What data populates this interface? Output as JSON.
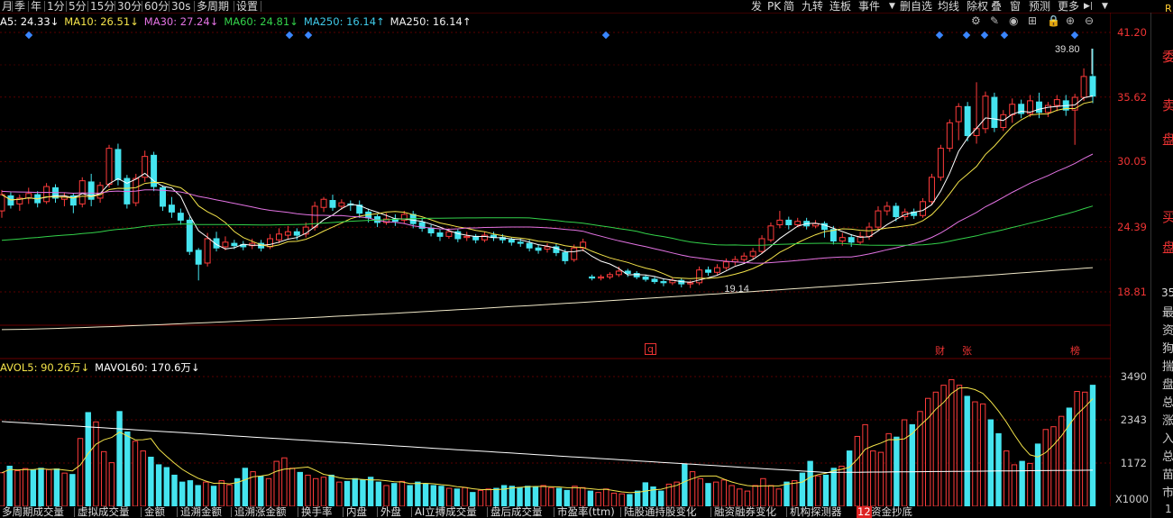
{
  "toolbar_left": [
    "月",
    "季",
    "年",
    "1分",
    "5分",
    "15分",
    "30分",
    "60分",
    "30s",
    "多周期",
    "设置"
  ],
  "toolbar_right": [
    "发",
    "PK",
    "简",
    "九转",
    "连板",
    "事件",
    "删自选",
    "均线",
    "除权",
    "叠",
    "窗",
    "预测",
    "更多"
  ],
  "ma_legend": [
    {
      "label": "A5: 24.33↓",
      "color": "#ffffff"
    },
    {
      "label": "MA10: 26.51↓",
      "color": "#f3e34a"
    },
    {
      "label": "MA30: 27.24↓",
      "color": "#e373e3"
    },
    {
      "label": "MA60: 24.81↓",
      "color": "#33d24a"
    },
    {
      "label": "MA250: 16.14↑",
      "color": "#3fc9e8"
    },
    {
      "label": "MA250: 16.14↑",
      "color": "#f0f0f0"
    }
  ],
  "vol_legend": [
    {
      "label": "AVOL5: 90.26万↓",
      "color": "#f3e34a"
    },
    {
      "label": "MAVOL60: 170.6万↓",
      "color": "#ffffff"
    }
  ],
  "price_axis": [
    "41.20",
    "35.62",
    "30.05",
    "24.39",
    "18.81"
  ],
  "price_high_label": "39.80",
  "price_low_label": "19.14",
  "vol_axis": [
    "3490",
    "2343",
    "1172"
  ],
  "vol_unit": "X1000",
  "tags": {
    "q": "q",
    "cai": "财",
    "zhang": "张",
    "bang": "榜"
  },
  "bottom_tabs": [
    "多周期成交量",
    "虚拟成交量",
    "金额",
    "追溯金额",
    "追溯涨金额",
    "换手率",
    "内盘",
    "外盘",
    "AI立搏成交量",
    "盘后成交量",
    "市盈率(ttm)",
    "陆股通持股变化",
    "融资融券变化",
    "机构探测器",
    "资金抄底"
  ],
  "bottom_badge": "12",
  "right_side": [
    "R",
    "委",
    "卖",
    "盘",
    "买",
    "盘",
    "35",
    "最",
    "资",
    "狗",
    "揣",
    "盘",
    "总",
    "涨",
    "入",
    "总",
    "苗",
    "市",
    "1"
  ],
  "colors": {
    "up": "#ff3b3b",
    "down": "#45e4ef",
    "grid": "#5a0000",
    "ma5": "#ffffff",
    "ma10": "#f3e34a",
    "ma30": "#e373e3",
    "ma60": "#33d24a",
    "ma250": "#f0e8c8",
    "icon": "#3a86ff"
  },
  "chart_data": {
    "type": "candlestick",
    "candles": [
      [
        25.8,
        27.2,
        25.2,
        27.6
      ],
      [
        27.1,
        26.3,
        26.0,
        27.4
      ],
      [
        26.4,
        26.9,
        25.8,
        27.2
      ],
      [
        26.9,
        27.3,
        26.4,
        27.8
      ],
      [
        27.2,
        26.5,
        26.1,
        27.5
      ],
      [
        26.6,
        27.9,
        26.4,
        28.2
      ],
      [
        27.8,
        26.9,
        26.5,
        28.1
      ],
      [
        26.8,
        27.0,
        26.2,
        27.4
      ],
      [
        27.1,
        26.3,
        25.6,
        27.3
      ],
      [
        26.4,
        28.4,
        26.1,
        28.7
      ],
      [
        28.3,
        26.8,
        26.2,
        29.0
      ],
      [
        26.9,
        28.0,
        26.5,
        28.3
      ],
      [
        28.1,
        31.2,
        27.8,
        31.5
      ],
      [
        31.1,
        28.5,
        28.0,
        31.6
      ],
      [
        28.6,
        26.4,
        26.0,
        28.9
      ],
      [
        26.5,
        28.6,
        26.2,
        29.0
      ],
      [
        28.7,
        30.5,
        28.3,
        31.0
      ],
      [
        30.6,
        27.9,
        27.5,
        30.9
      ],
      [
        27.8,
        26.2,
        25.8,
        28.0
      ],
      [
        26.3,
        25.7,
        25.2,
        27.0
      ],
      [
        25.6,
        25.0,
        24.6,
        26.0
      ],
      [
        25.0,
        22.3,
        22.0,
        25.3
      ],
      [
        22.4,
        21.2,
        19.8,
        22.6
      ],
      [
        21.3,
        23.4,
        21.0,
        23.9
      ],
      [
        23.4,
        22.6,
        22.3,
        24.0
      ],
      [
        22.7,
        23.1,
        22.4,
        23.6
      ],
      [
        23.0,
        22.8,
        22.5,
        23.3
      ],
      [
        22.9,
        22.7,
        22.4,
        23.2
      ],
      [
        22.8,
        23.0,
        22.5,
        23.4
      ],
      [
        23.0,
        22.6,
        22.3,
        23.3
      ],
      [
        22.7,
        23.4,
        22.5,
        23.8
      ],
      [
        23.3,
        23.8,
        23.0,
        24.3
      ],
      [
        23.7,
        24.0,
        23.4,
        24.5
      ],
      [
        24.0,
        23.7,
        23.3,
        24.3
      ],
      [
        23.8,
        24.4,
        23.5,
        24.8
      ],
      [
        24.4,
        26.2,
        24.1,
        26.6
      ],
      [
        26.1,
        26.8,
        25.7,
        27.0
      ],
      [
        26.7,
        26.1,
        25.8,
        27.2
      ],
      [
        26.2,
        26.5,
        25.9,
        26.8
      ],
      [
        26.4,
        26.3,
        25.8,
        26.7
      ],
      [
        26.3,
        25.6,
        25.2,
        26.7
      ],
      [
        25.7,
        25.2,
        24.8,
        26.0
      ],
      [
        25.3,
        24.8,
        24.4,
        25.5
      ],
      [
        24.8,
        25.1,
        24.6,
        25.6
      ],
      [
        25.1,
        24.9,
        24.5,
        25.5
      ],
      [
        25.0,
        25.5,
        24.7,
        25.8
      ],
      [
        25.5,
        24.7,
        24.3,
        25.8
      ],
      [
        24.8,
        24.3,
        24.0,
        25.2
      ],
      [
        24.3,
        23.9,
        23.6,
        24.6
      ],
      [
        23.9,
        23.6,
        23.2,
        24.2
      ],
      [
        23.6,
        24.0,
        23.4,
        24.3
      ],
      [
        24.0,
        23.4,
        23.1,
        24.2
      ],
      [
        23.5,
        23.6,
        23.2,
        24.0
      ],
      [
        23.6,
        23.3,
        23.0,
        23.8
      ],
      [
        23.3,
        23.7,
        23.1,
        24.0
      ],
      [
        23.7,
        23.5,
        23.2,
        24.0
      ],
      [
        23.5,
        23.3,
        23.0,
        23.8
      ],
      [
        23.3,
        23.1,
        22.8,
        23.5
      ],
      [
        23.1,
        23.0,
        22.7,
        23.4
      ],
      [
        23.0,
        22.6,
        22.3,
        23.3
      ],
      [
        22.6,
        22.4,
        22.1,
        22.9
      ],
      [
        22.5,
        22.7,
        22.2,
        23.0
      ],
      [
        22.7,
        22.2,
        21.9,
        23.0
      ],
      [
        22.2,
        21.5,
        21.2,
        22.5
      ],
      [
        21.6,
        22.6,
        21.4,
        22.9
      ],
      [
        22.6,
        23.1,
        22.3,
        23.4
      ],
      [
        20.1,
        20.0,
        19.8,
        20.3
      ],
      [
        20.0,
        20.1,
        19.8,
        20.3
      ],
      [
        20.1,
        20.3,
        19.9,
        20.5
      ],
      [
        20.3,
        20.6,
        20.1,
        21.0
      ],
      [
        20.6,
        20.4,
        20.1,
        20.8
      ],
      [
        20.4,
        20.1,
        19.9,
        20.6
      ],
      [
        20.1,
        19.9,
        19.7,
        20.3
      ],
      [
        19.9,
        19.7,
        19.5,
        20.1
      ],
      [
        19.7,
        19.6,
        19.3,
        19.9
      ],
      [
        19.6,
        19.8,
        19.4,
        20.0
      ],
      [
        19.8,
        19.5,
        19.2,
        20.0
      ],
      [
        19.5,
        19.6,
        19.14,
        19.8
      ],
      [
        19.6,
        20.7,
        19.4,
        21.0
      ],
      [
        20.7,
        20.5,
        20.2,
        21.0
      ],
      [
        20.5,
        20.9,
        20.3,
        21.2
      ],
      [
        20.9,
        21.4,
        20.7,
        21.7
      ],
      [
        21.4,
        21.6,
        21.1,
        21.9
      ],
      [
        21.6,
        21.9,
        21.4,
        22.2
      ],
      [
        21.9,
        22.3,
        21.6,
        22.6
      ],
      [
        22.3,
        23.4,
        22.1,
        23.7
      ],
      [
        23.3,
        24.5,
        23.1,
        24.8
      ],
      [
        24.6,
        25.0,
        24.3,
        25.8
      ],
      [
        25.0,
        24.6,
        24.2,
        25.3
      ],
      [
        24.6,
        24.9,
        24.4,
        25.2
      ],
      [
        24.9,
        24.5,
        24.2,
        25.2
      ],
      [
        24.5,
        24.7,
        24.3,
        25.0
      ],
      [
        24.7,
        24.2,
        23.5,
        24.9
      ],
      [
        24.2,
        23.2,
        22.9,
        24.5
      ],
      [
        23.2,
        23.5,
        22.8,
        23.9
      ],
      [
        23.5,
        23.1,
        22.7,
        23.8
      ],
      [
        23.1,
        23.6,
        22.9,
        24.0
      ],
      [
        23.6,
        24.4,
        23.3,
        24.8
      ],
      [
        24.4,
        25.8,
        24.2,
        26.2
      ],
      [
        25.8,
        26.2,
        25.4,
        26.6
      ],
      [
        26.2,
        25.3,
        24.9,
        26.5
      ],
      [
        25.3,
        25.7,
        25.0,
        26.0
      ],
      [
        25.7,
        25.4,
        25.1,
        26.0
      ],
      [
        25.4,
        26.6,
        25.2,
        26.9
      ],
      [
        26.6,
        28.7,
        26.3,
        29.0
      ],
      [
        28.7,
        31.2,
        28.4,
        31.5
      ],
      [
        31.2,
        33.4,
        30.9,
        33.7
      ],
      [
        33.5,
        34.8,
        31.9,
        35.1
      ],
      [
        34.8,
        32.3,
        31.8,
        35.2
      ],
      [
        32.3,
        32.9,
        31.6,
        36.9
      ],
      [
        32.9,
        35.7,
        32.5,
        36.1
      ],
      [
        35.6,
        33.0,
        32.6,
        36.0
      ],
      [
        33.0,
        34.1,
        32.7,
        34.5
      ],
      [
        34.1,
        35.0,
        33.4,
        35.5
      ],
      [
        35.0,
        34.2,
        33.8,
        35.4
      ],
      [
        34.2,
        35.3,
        33.9,
        35.8
      ],
      [
        35.2,
        34.3,
        33.8,
        36.0
      ],
      [
        34.3,
        34.9,
        33.9,
        35.2
      ],
      [
        34.9,
        35.4,
        34.4,
        35.8
      ],
      [
        35.3,
        34.5,
        34.0,
        35.8
      ],
      [
        34.5,
        35.6,
        31.5,
        35.9
      ],
      [
        35.6,
        37.4,
        35.3,
        38.1
      ],
      [
        37.4,
        35.7,
        35.1,
        39.8
      ]
    ],
    "volume_wan": [
      97,
      116,
      103,
      109,
      105,
      110,
      106,
      108,
      96,
      92,
      196,
      271,
      244,
      158,
      126,
      274,
      215,
      188,
      160,
      142,
      120,
      112,
      90,
      70,
      74,
      60,
      70,
      58,
      74,
      62,
      80,
      110,
      100,
      86,
      80,
      130,
      140,
      110,
      98,
      90,
      80,
      84,
      90,
      70,
      72,
      80,
      76,
      84,
      70,
      60,
      66,
      72,
      60,
      70,
      64,
      60,
      58,
      52,
      50,
      54,
      40,
      46,
      50,
      52,
      60,
      58,
      54,
      58,
      56,
      60,
      54,
      52,
      46,
      58,
      54,
      44,
      40,
      50,
      38,
      36,
      34,
      44,
      68,
      56,
      44,
      64,
      70,
      122,
      100,
      80,
      66,
      70,
      76,
      60,
      50,
      44,
      60,
      80,
      60,
      50,
      70,
      74,
      96,
      130,
      88,
      90,
      110,
      116,
      160,
      202,
      236,
      160,
      156,
      210,
      200,
      250,
      236,
      274,
      312,
      330,
      350,
      366,
      350,
      318,
      302,
      296,
      250,
      210,
      160,
      120,
      130,
      124,
      180,
      222,
      230,
      260,
      284,
      332,
      330,
      350
    ]
  }
}
